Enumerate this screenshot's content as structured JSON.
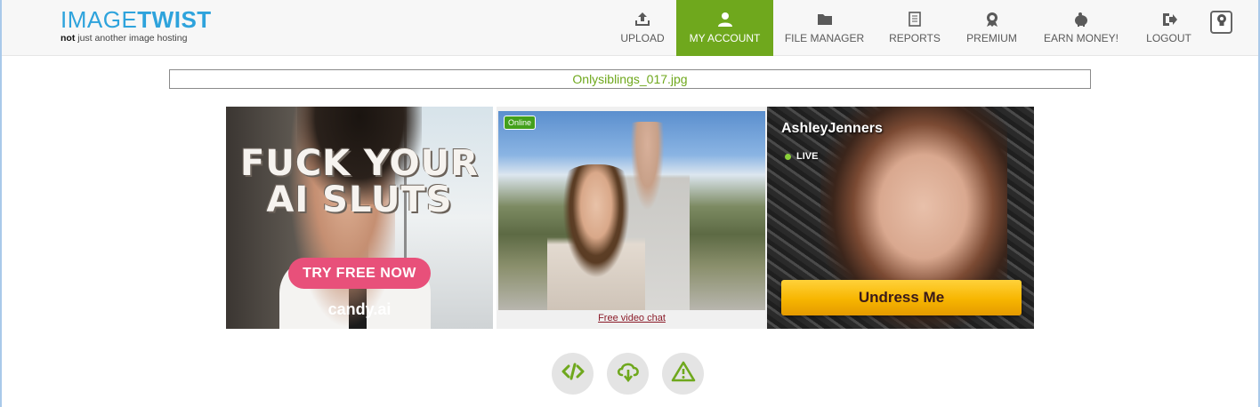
{
  "header": {
    "logo": {
      "part1": "IMAGE",
      "part2": "TWIST",
      "tagline_bold": "not",
      "tagline_rest": " just another image hosting"
    },
    "nav": [
      {
        "label": "UPLOAD",
        "icon": "upload-icon"
      },
      {
        "label": "MY ACCOUNT",
        "icon": "user-icon",
        "active": true
      },
      {
        "label": "FILE MANAGER",
        "icon": "folder-icon"
      },
      {
        "label": "REPORTS",
        "icon": "report-icon"
      },
      {
        "label": "PREMIUM",
        "icon": "award-icon"
      },
      {
        "label": "EARN MONEY!",
        "icon": "piggy-bank-icon"
      },
      {
        "label": "LOGOUT",
        "icon": "logout-icon"
      }
    ],
    "theme_button_icon": "lightbulb-icon"
  },
  "file": {
    "name": "Onlysiblings_017.jpg"
  },
  "ads": {
    "ad1": {
      "headline": "FUCK YOUR AI SLUTS",
      "cta": "TRY FREE NOW",
      "brand": "candy.ai"
    },
    "ad2": {
      "badge": "Online",
      "link": "Free video chat"
    },
    "ad3": {
      "name": "AshleyJenners",
      "status": "LIVE",
      "cta": "Undress Me"
    }
  },
  "actions": [
    {
      "icon": "code-icon"
    },
    {
      "icon": "cloud-download-icon"
    },
    {
      "icon": "warning-icon"
    }
  ],
  "colors": {
    "accent": "#6fa81d",
    "brand_blue": "#2ea3dc",
    "cta_pink": "#e8507a",
    "cta_gold": "#f7b500"
  }
}
